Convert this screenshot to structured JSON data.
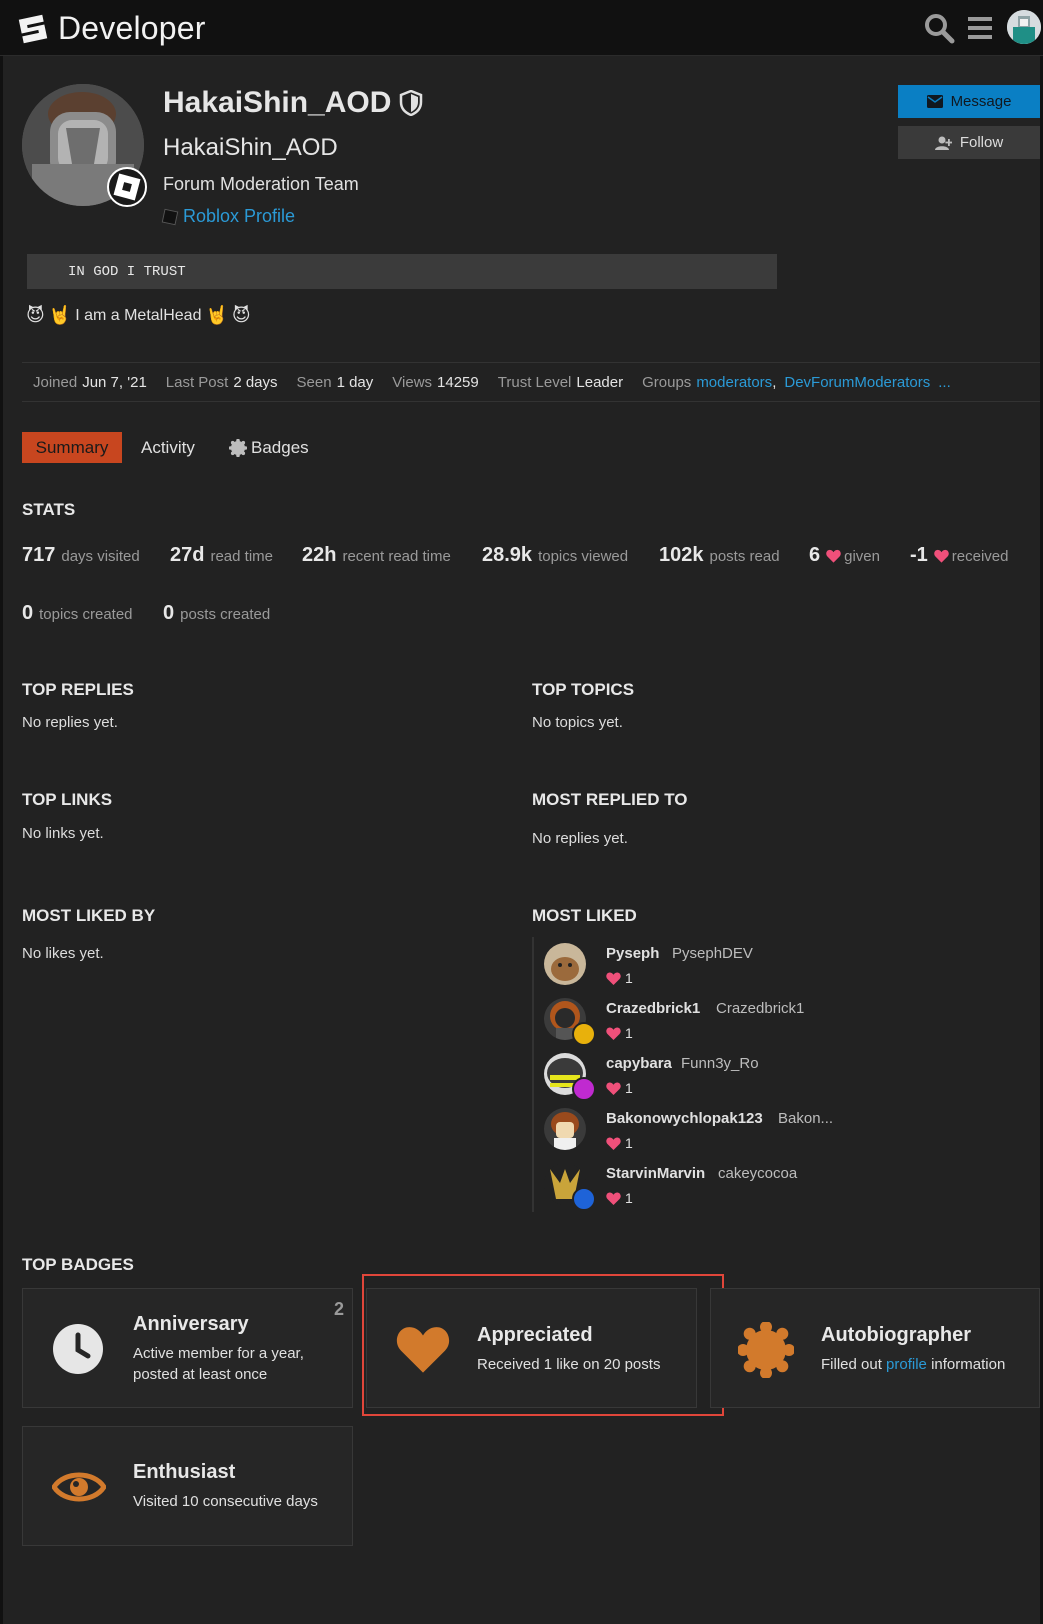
{
  "header": {
    "logo_text": "Developer"
  },
  "profile": {
    "username": "HakaiShin_AOD",
    "full_name": "HakaiShin_AOD",
    "title": "Forum Moderation Team",
    "roblox_link": "Roblox Profile",
    "bio_code": "IN GOD I TRUST",
    "bio_text": "I am a MetalHead",
    "message_label": "Message",
    "follow_label": "Follow"
  },
  "meta": {
    "joined_label": "Joined",
    "joined_value": "Jun 7, '21",
    "last_post_label": "Last Post",
    "last_post_value": "2 days",
    "seen_label": "Seen",
    "seen_value": "1 day",
    "views_label": "Views",
    "views_value": "14259",
    "trust_label": "Trust Level",
    "trust_value": "Leader",
    "groups_label": "Groups",
    "groups": [
      "moderators",
      "DevForumModerators"
    ],
    "groups_more": "..."
  },
  "tabs": {
    "summary": "Summary",
    "activity": "Activity",
    "badges": "Badges"
  },
  "stats": {
    "heading": "STATS",
    "items": [
      {
        "num": "717",
        "label": "days visited"
      },
      {
        "num": "27d",
        "label": "read time"
      },
      {
        "num": "22h",
        "label": "recent read time"
      },
      {
        "num": "28.9k",
        "label": "topics viewed"
      },
      {
        "num": "102k",
        "label": "posts read"
      },
      {
        "num": "6",
        "label": "given"
      },
      {
        "num": "-1",
        "label": "received"
      },
      {
        "num": "0",
        "label": "topics created"
      },
      {
        "num": "0",
        "label": "posts created"
      }
    ]
  },
  "sections": {
    "top_replies": "TOP REPLIES",
    "top_replies_empty": "No replies yet.",
    "top_topics": "TOP TOPICS",
    "top_topics_empty": "No topics yet.",
    "top_links": "TOP LINKS",
    "top_links_empty": "No links yet.",
    "most_replied": "MOST REPLIED TO",
    "most_replied_empty": "No replies yet.",
    "most_liked_by": "MOST LIKED BY",
    "most_liked_by_empty": "No likes yet.",
    "most_liked": "MOST LIKED",
    "top_badges": "TOP BADGES"
  },
  "most_liked": [
    {
      "name": "Pyseph",
      "user": "PysephDEV",
      "count": "1"
    },
    {
      "name": "Crazedbrick1",
      "user": "Crazedbrick1",
      "count": "1"
    },
    {
      "name": "capybara",
      "user": "Funn3y_Ro",
      "count": "1"
    },
    {
      "name": "Bakonowychlopak123",
      "user": "Bakon...",
      "count": "1"
    },
    {
      "name": "StarvinMarvin",
      "user": "cakeycocoa",
      "count": "1"
    }
  ],
  "badges": [
    {
      "title": "Anniversary",
      "desc_1": "Active member for a year,",
      "desc_2": "posted at least once",
      "count": "2"
    },
    {
      "title": "Appreciated",
      "desc": "Received 1 like on 20 posts"
    },
    {
      "title": "Autobiographer",
      "desc_pre": "Filled out",
      "desc_link": "profile",
      "desc_post": "information"
    },
    {
      "title": "Enthusiast",
      "desc": "Visited 10 consecutive days"
    }
  ],
  "colors": {
    "accent_orange": "#c8461f",
    "link_blue": "#2b9ad6",
    "heart_pink": "#f0507a",
    "badge_bronze": "#d27a2c",
    "highlight_red": "#e0463a"
  }
}
